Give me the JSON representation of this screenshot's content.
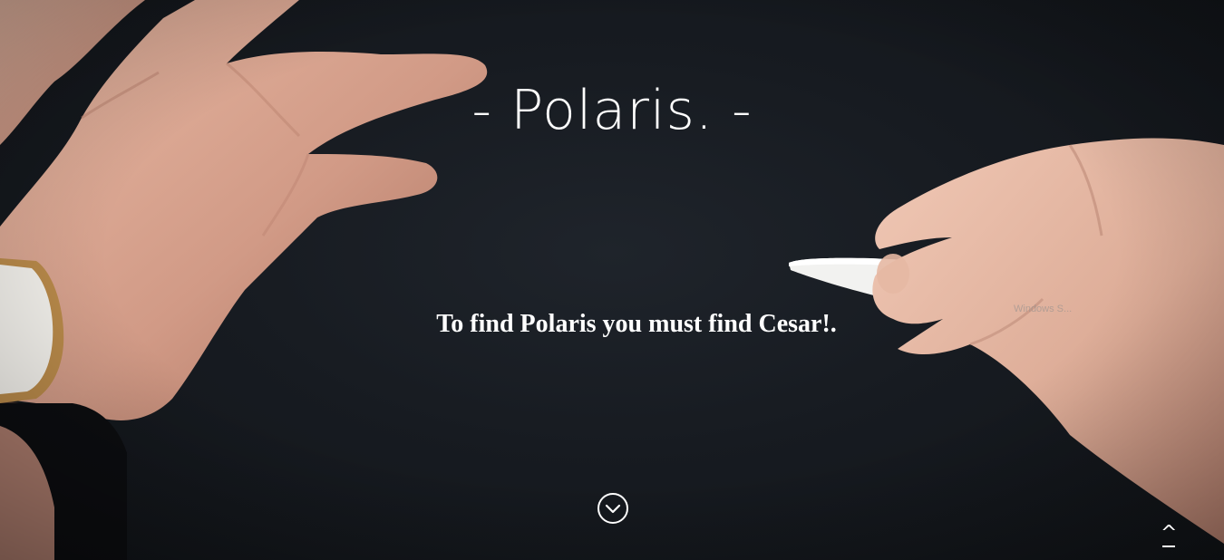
{
  "hero": {
    "title": "- Polaris. -",
    "tagline": "To find Polaris you must find Cesar!.",
    "scroll_down_icon": "chevron-down-circle-icon",
    "back_to_top_label": "^"
  },
  "watermark": {
    "text": "Windows S..."
  },
  "colors": {
    "background": "#15181d",
    "text": "#ffffff",
    "skin": "#d9a891",
    "watch_gold": "#b98a4a"
  }
}
